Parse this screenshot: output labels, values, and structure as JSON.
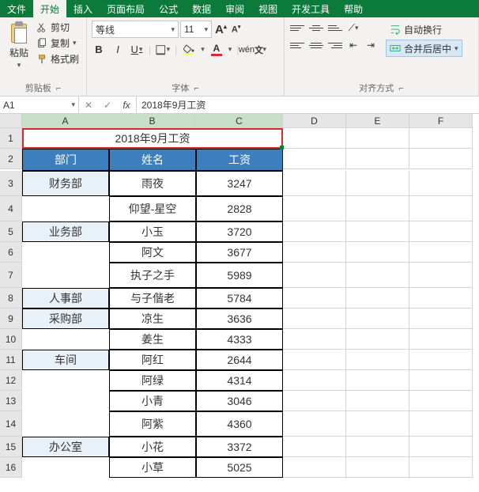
{
  "tabs": {
    "file": "文件",
    "home": "开始",
    "insert": "插入",
    "layout": "页面布局",
    "formulas": "公式",
    "data": "数据",
    "review": "审阅",
    "view": "视图",
    "dev": "开发工具",
    "help": "帮助"
  },
  "ribbon": {
    "clipboard": {
      "paste": "粘贴",
      "cut": "剪切",
      "copy": "复制",
      "format_painter": "格式刷",
      "group": "剪贴板"
    },
    "font": {
      "name": "等线",
      "size": "11",
      "group": "字体",
      "fill_color": "#ffff66",
      "font_color": "#d92b2b"
    },
    "align": {
      "wrap": "自动换行",
      "merge": "合并后居中",
      "group": "对齐方式"
    }
  },
  "namebox": "A1",
  "formula": "2018年9月工资",
  "columns": [
    "A",
    "B",
    "C",
    "D",
    "E",
    "F"
  ],
  "rows": [
    "1",
    "2",
    "3",
    "4",
    "5",
    "6",
    "7",
    "8",
    "9",
    "10",
    "11",
    "12",
    "13",
    "14",
    "15",
    "16"
  ],
  "sheet": {
    "title": "2018年9月工资",
    "headers": {
      "dep": "部门",
      "name": "姓名",
      "salary": "工资"
    },
    "data": [
      {
        "dep": "财务部",
        "rows": [
          {
            "name": "雨夜",
            "salary": "3247"
          },
          {
            "name": "仰望-星空",
            "salary": "2828"
          }
        ]
      },
      {
        "dep": "业务部",
        "rows": [
          {
            "name": "小玉",
            "salary": "3720"
          },
          {
            "name": "阿文",
            "salary": "3677"
          },
          {
            "name": "执子之手",
            "salary": "5989"
          }
        ]
      },
      {
        "dep": "人事部",
        "rows": [
          {
            "name": "与子偕老",
            "salary": "5784"
          }
        ]
      },
      {
        "dep": "采购部",
        "rows": [
          {
            "name": "凉生",
            "salary": "3636"
          },
          {
            "name": "姜生",
            "salary": "4333"
          }
        ]
      },
      {
        "dep": "车间",
        "rows": [
          {
            "name": "阿红",
            "salary": "2644"
          },
          {
            "name": "阿绿",
            "salary": "4314"
          },
          {
            "name": "小青",
            "salary": "3046"
          },
          {
            "name": "阿紫",
            "salary": "4360"
          }
        ]
      },
      {
        "dep": "办公室",
        "rows": [
          {
            "name": "小花",
            "salary": "3372"
          },
          {
            "name": "小草",
            "salary": "5025"
          }
        ]
      }
    ]
  }
}
